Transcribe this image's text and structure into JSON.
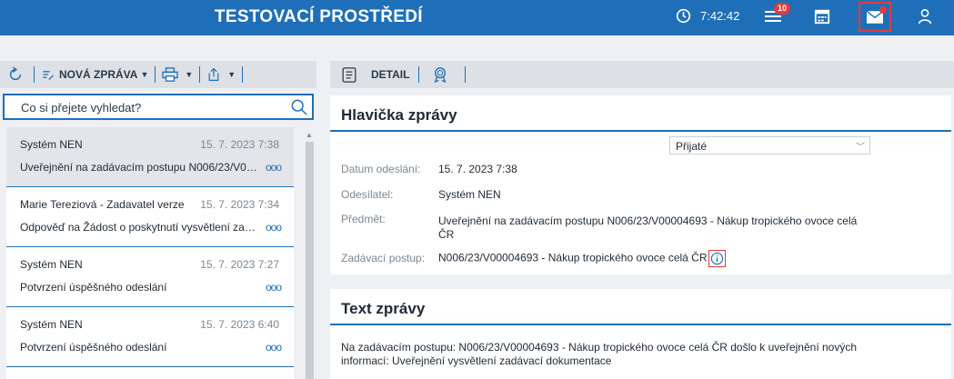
{
  "header": {
    "title": "TESTOVACÍ PROSTŘEDÍ",
    "time": "7:42:42",
    "notification_count": "10"
  },
  "left_toolbar": {
    "new_message_label": "NOVÁ ZPRÁVA"
  },
  "search": {
    "placeholder": "Co si přejete vyhledat?"
  },
  "messages": [
    {
      "sender": "Systém NEN",
      "date": "15. 7. 2023 7:38",
      "subject": "Uveřejnění na zadávacím postupu N006/23/V00004693 - Nákup tropického ovoce celá ČR",
      "selected": true
    },
    {
      "sender": "Marie Tereziová - Zadavatel verze",
      "date": "15. 7. 2023 7:34",
      "subject": "Odpověď na Žádost o poskytnutí vysvětlení zadávací dokumentace",
      "selected": false
    },
    {
      "sender": "Systém NEN",
      "date": "15. 7. 2023 7:27",
      "subject": "Potvrzení úspěšného odeslání",
      "selected": false
    },
    {
      "sender": "Systém NEN",
      "date": "15. 7. 2023 6:40",
      "subject": "Potvrzení úspěšného odeslání",
      "selected": false
    }
  ],
  "more_glyph": "ooo",
  "right_toolbar": {
    "detail_label": "DETAIL"
  },
  "message_header": {
    "title": "Hlavička zprávy",
    "status_select": "Přijaté",
    "sent_date_label": "Datum odeslání:",
    "sent_date": "15. 7. 2023 7:38",
    "sender_label": "Odesílatel:",
    "sender": "Systém NEN",
    "subject_label": "Předmět:",
    "subject": "Uveřejnění na zadávacím postupu N006/23/V00004693 - Nákup tropického ovoce celá ČR",
    "procedure_label": "Zadávací postup:",
    "procedure": "N006/23/V00004693 - Nákup tropického ovoce celá ČR"
  },
  "message_text": {
    "title": "Text zprávy",
    "body": "Na zadávacím postupu: N006/23/V00004693 - Nákup tropického ovoce celá ČR došlo k uveřejnění nových informací: Uveřejnění vysvětlení zadávací dokumentace"
  },
  "colors": {
    "brand": "#1f6fb8",
    "alert": "#e23b3b"
  }
}
